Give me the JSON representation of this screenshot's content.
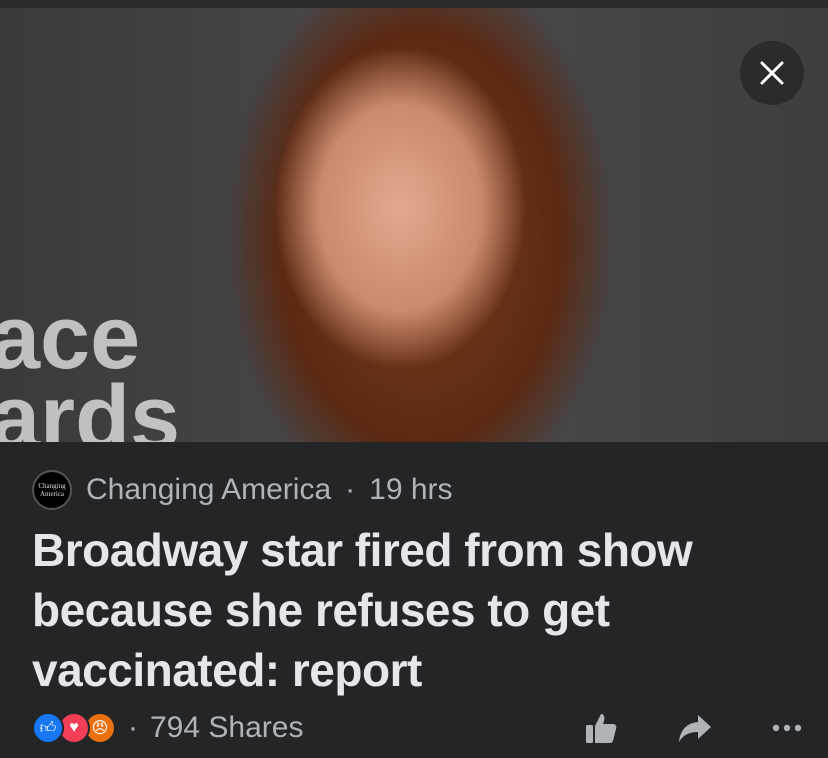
{
  "photo": {
    "background_text": "ace\nards"
  },
  "post": {
    "source": "Changing America",
    "source_logo_text": "Changing America",
    "time": "19 hrs",
    "headline": "Broadway star fired from show because she refuses to get vaccinated: report"
  },
  "footer": {
    "reactions": [
      "like-icon",
      "love-icon",
      "angry-icon"
    ],
    "reaction_colors": {
      "like": "#1877f2",
      "love": "#f33e58",
      "angry": "#e9710f"
    },
    "shares": "794 Shares"
  }
}
